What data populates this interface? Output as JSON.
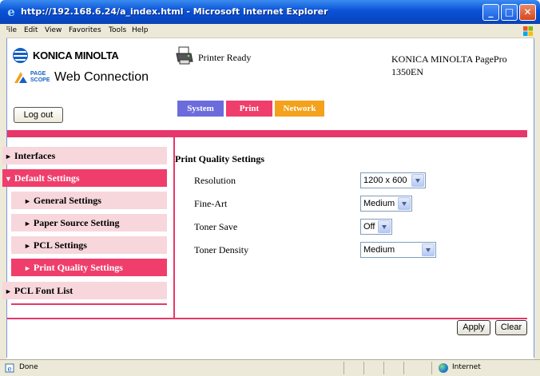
{
  "window": {
    "title": "http://192.168.6.24/a_index.html - Microsoft Internet Explorer",
    "minimize": "_",
    "maximize": "□",
    "close": "✕"
  },
  "menu": [
    "File",
    "Edit",
    "View",
    "Favorites",
    "Tools",
    "Help"
  ],
  "header": {
    "konica_logo_text": "KONICA MINOLTA",
    "pagescope_brand": "PAGE SCOPE",
    "web_connection": "Web Connection",
    "printer_status": "Printer Ready",
    "model_line1": "KONICA MINOLTA PagePro",
    "model_line2": "1350EN",
    "logout": "Log out"
  },
  "tabs": {
    "system": "System",
    "print": "Print",
    "network": "Network",
    "active": "Print",
    "colors": {
      "system": "#6b6bdc",
      "print": "#ef3e6b",
      "network": "#f4a11c"
    }
  },
  "nav": {
    "arrow_right": "►",
    "arrow_down": "▼",
    "items": [
      {
        "label": "Interfaces",
        "level": 1,
        "active": false,
        "expanded": false
      },
      {
        "label": "Default Settings",
        "level": 1,
        "active": true,
        "expanded": true
      },
      {
        "label": "General Settings",
        "level": 2,
        "active": false
      },
      {
        "label": "Paper Source Setting",
        "level": 2,
        "active": false
      },
      {
        "label": "PCL Settings",
        "level": 2,
        "active": false
      },
      {
        "label": "Print Quality Settings",
        "level": 2,
        "active": true
      },
      {
        "label": "PCL Font List",
        "level": 1,
        "active": false,
        "expanded": false
      }
    ]
  },
  "main": {
    "section_title": "Print Quality Settings",
    "settings": [
      {
        "label": "Resolution",
        "value": "1200 x 600"
      },
      {
        "label": "Fine-Art",
        "value": "Medium"
      },
      {
        "label": "Toner Save",
        "value": "Off"
      },
      {
        "label": "Toner Density",
        "value": "Medium"
      }
    ],
    "apply": "Apply",
    "clear": "Clear"
  },
  "statusbar": {
    "status": "Done",
    "zone": "Internet"
  },
  "accent_color": "#e8366a"
}
